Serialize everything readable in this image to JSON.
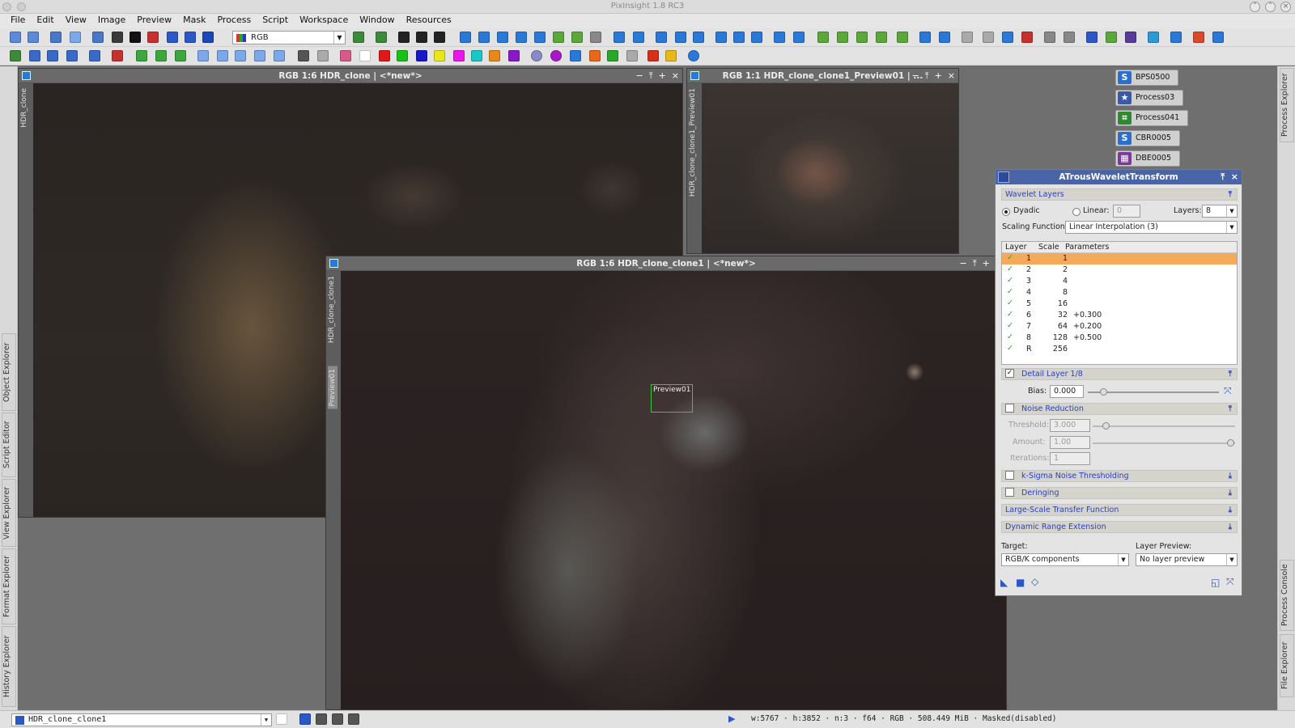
{
  "app": {
    "title": "PixInsight 1.8 RC3"
  },
  "menu": [
    "File",
    "Edit",
    "View",
    "Image",
    "Preview",
    "Mask",
    "Process",
    "Script",
    "Workspace",
    "Window",
    "Resources"
  ],
  "toolbar": {
    "colorspace": "RGB"
  },
  "windows": {
    "win1": {
      "title": "RGB 1:6 HDR_clone | <*new*>",
      "tab": "HDR_clone"
    },
    "win2": {
      "title": "RGB 1:1 HDR_clone_clone1_Preview01 | ...",
      "tab": "HDR_clone_clone1_Preview01"
    },
    "win3": {
      "title": "RGB 1:6 HDR_clone_clone1 | <*new*>",
      "tab": "HDR_clone_clone1",
      "tab2": "Preview01",
      "preview_label": "Preview01"
    }
  },
  "left_dock": [
    "Object Explorer",
    "Script Editor",
    "View Explorer",
    "Format Explorer",
    "History Explorer"
  ],
  "right_dock": [
    "Process Explorer",
    "Process Console",
    "File Explorer"
  ],
  "icons": [
    {
      "name": "BPS0500",
      "color": "#2a6fd0",
      "glyph": "S"
    },
    {
      "name": "Process03",
      "color": "#3a5aa8",
      "glyph": "★"
    },
    {
      "name": "Process041",
      "color": "#2e8a2e",
      "glyph": "⌗"
    },
    {
      "name": "CBR0005",
      "color": "#2a6fd0",
      "glyph": "S"
    },
    {
      "name": "DBE0005",
      "color": "#7a3a9a",
      "glyph": "▦"
    }
  ],
  "atrous": {
    "title": "ATrousWaveletTransform",
    "wavelet_layers": "Wavelet Layers",
    "dyadic": "Dyadic",
    "linear": "Linear:",
    "linear_value": "0",
    "layers_label": "Layers:",
    "layers_value": "8",
    "scaling_label": "Scaling Function:",
    "scaling_value": "Linear Interpolation (3)",
    "headers": [
      "Layer",
      "Scale",
      "Parameters"
    ],
    "rows": [
      {
        "layer": "1",
        "scale": "1",
        "params": ""
      },
      {
        "layer": "2",
        "scale": "2",
        "params": ""
      },
      {
        "layer": "3",
        "scale": "4",
        "params": ""
      },
      {
        "layer": "4",
        "scale": "8",
        "params": ""
      },
      {
        "layer": "5",
        "scale": "16",
        "params": ""
      },
      {
        "layer": "6",
        "scale": "32",
        "params": "+0.300"
      },
      {
        "layer": "7",
        "scale": "64",
        "params": "+0.200"
      },
      {
        "layer": "8",
        "scale": "128",
        "params": "+0.500"
      },
      {
        "layer": "R",
        "scale": "256",
        "params": ""
      }
    ],
    "detail_layer": "Detail Layer 1/8",
    "bias_label": "Bias:",
    "bias_value": "0.000",
    "bias_fraction": 0.1,
    "noise_reduction": "Noise Reduction",
    "threshold_label": "Threshold:",
    "threshold_value": "3.000",
    "amount_label": "Amount:",
    "amount_value": "1.00",
    "iterations_label": "Iterations:",
    "iterations_value": "1",
    "ksigma": "k-Sigma Noise Thresholding",
    "deringing": "Deringing",
    "lstf": "Large-Scale Transfer Function",
    "dre": "Dynamic Range Extension",
    "target_label": "Target:",
    "target_value": "RGB/K components",
    "layer_preview_label": "Layer Preview:",
    "layer_preview_value": "No layer preview"
  },
  "status": {
    "view": "HDR_clone_clone1",
    "info": "w:5767 · h:3852 · n:3 · f64 · RGB · 508.449 MiB · Masked(disabled)"
  }
}
